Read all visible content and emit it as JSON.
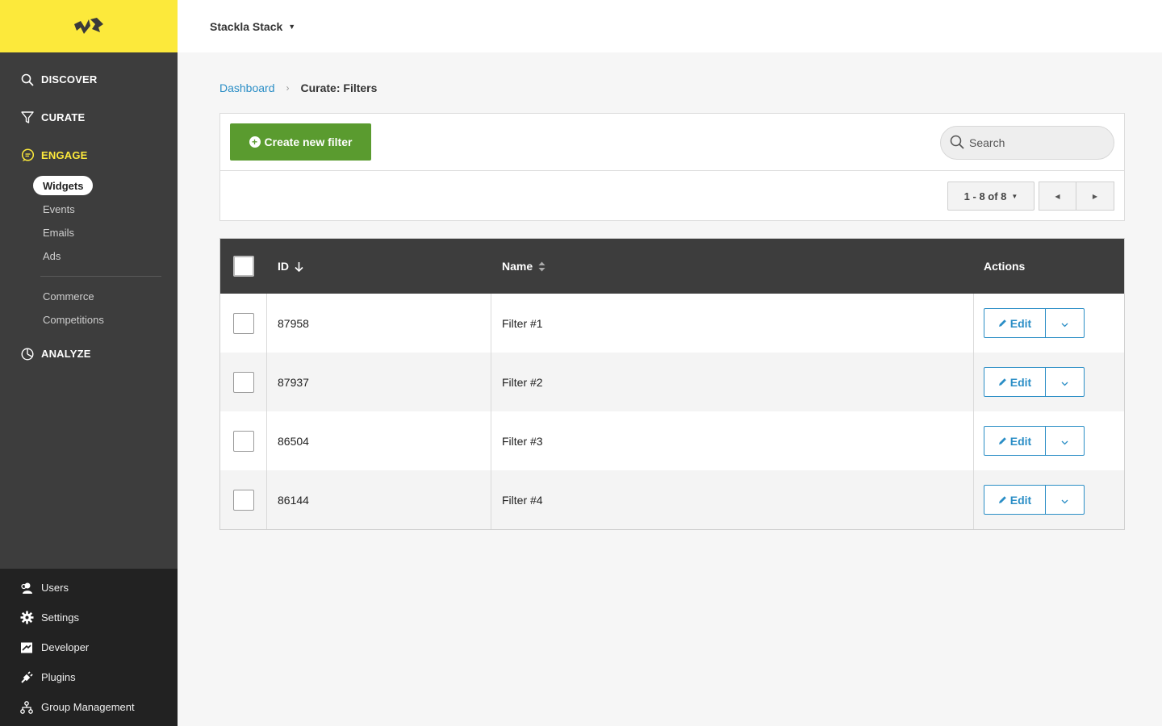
{
  "header": {
    "stack_name": "Stackla Stack"
  },
  "sidebar": {
    "main": [
      {
        "label": "DISCOVER",
        "icon": "search-icon"
      },
      {
        "label": "CURATE",
        "icon": "filter-icon"
      },
      {
        "label": "ENGAGE",
        "icon": "chat-icon",
        "active": true
      },
      {
        "label": "ANALYZE",
        "icon": "pie-chart-icon"
      }
    ],
    "engage_sub": [
      "Widgets",
      "Events",
      "Emails",
      "Ads"
    ],
    "engage_sub2": [
      "Commerce",
      "Competitions"
    ],
    "bottom": [
      {
        "label": "Users",
        "icon": "users-icon"
      },
      {
        "label": "Settings",
        "icon": "gear-icon"
      },
      {
        "label": "Developer",
        "icon": "developer-icon"
      },
      {
        "label": "Plugins",
        "icon": "plug-icon"
      },
      {
        "label": "Group Management",
        "icon": "hierarchy-icon"
      }
    ],
    "accent_color": "#fce93b"
  },
  "breadcrumb": {
    "root": "Dashboard",
    "current": "Curate: Filters"
  },
  "toolbar": {
    "create_label": "Create new filter",
    "search_placeholder": "Search",
    "pager_label": "1 - 8 of 8"
  },
  "table": {
    "headers": {
      "id": "ID",
      "name": "Name",
      "actions": "Actions"
    },
    "edit_label": "Edit",
    "rows": [
      {
        "id": "87958",
        "name": "Filter #1"
      },
      {
        "id": "87937",
        "name": "Filter #2"
      },
      {
        "id": "86504",
        "name": "Filter #3"
      },
      {
        "id": "86144",
        "name": "Filter #4"
      }
    ]
  },
  "colors": {
    "primary_button": "#5a9b2f",
    "link": "#2b8ec6",
    "sidebar_bg": "#3d3d3d"
  }
}
